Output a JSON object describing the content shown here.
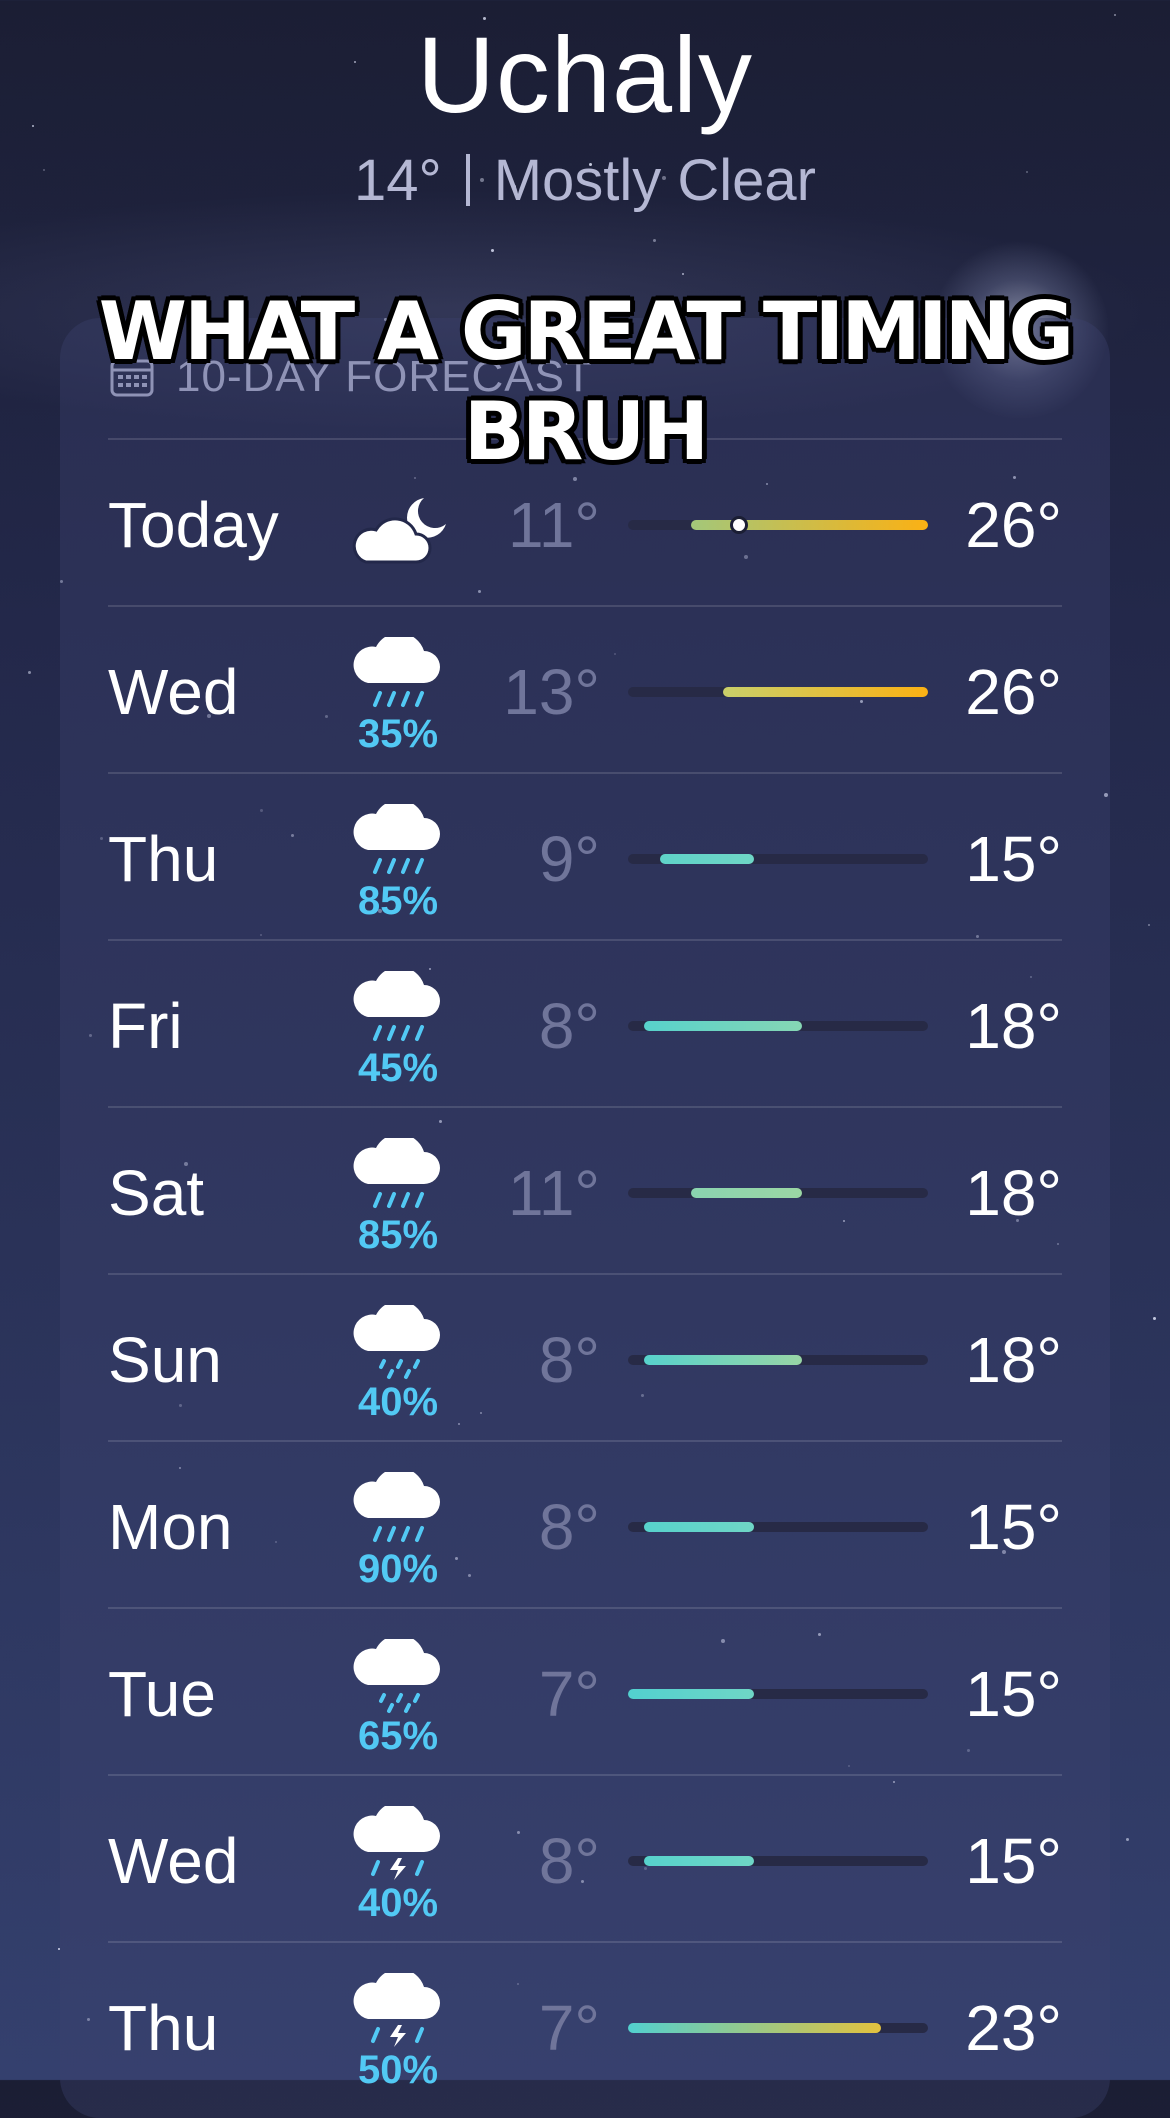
{
  "header": {
    "city": "Uchaly",
    "temp": "14°",
    "condition": "Mostly Clear"
  },
  "forecast": {
    "title": "10-DAY FORECAST",
    "icon": "calendar-icon"
  },
  "caption": {
    "line1": "WHAT A GREAT TIMING",
    "line2": "BRUH"
  },
  "scale": {
    "min": 7,
    "max": 26
  },
  "current_temp": 14,
  "days": [
    {
      "label": "Today",
      "icon": "moon-cloud-icon",
      "precip": "",
      "low": "11°",
      "high": "26°",
      "lo": 11,
      "hi": 26,
      "c1": "#a3c77a",
      "c2": "#fbb114",
      "now": true
    },
    {
      "label": "Wed",
      "icon": "rain-cloud-icon",
      "precip": "35%",
      "low": "13°",
      "high": "26°",
      "lo": 13,
      "hi": 26,
      "c1": "#c9cf6a",
      "c2": "#fbb114"
    },
    {
      "label": "Thu",
      "icon": "rain-cloud-icon",
      "precip": "85%",
      "low": "9°",
      "high": "15°",
      "lo": 9,
      "hi": 15,
      "c1": "#5fd3c8",
      "c2": "#6fd6c6"
    },
    {
      "label": "Fri",
      "icon": "rain-cloud-icon",
      "precip": "45%",
      "low": "8°",
      "high": "18°",
      "lo": 8,
      "hi": 18,
      "c1": "#57d2cc",
      "c2": "#86d6b4"
    },
    {
      "label": "Sat",
      "icon": "rain-cloud-icon",
      "precip": "85%",
      "low": "11°",
      "high": "18°",
      "lo": 11,
      "hi": 18,
      "c1": "#8ad4b0",
      "c2": "#9bd6a4"
    },
    {
      "label": "Sun",
      "icon": "drizzle-cloud-icon",
      "precip": "40%",
      "low": "8°",
      "high": "18°",
      "lo": 8,
      "hi": 18,
      "c1": "#57d2cc",
      "c2": "#98d5a6"
    },
    {
      "label": "Mon",
      "icon": "rain-cloud-icon",
      "precip": "90%",
      "low": "8°",
      "high": "15°",
      "lo": 8,
      "hi": 15,
      "c1": "#57d2cc",
      "c2": "#6fd6c6"
    },
    {
      "label": "Tue",
      "icon": "drizzle-cloud-icon",
      "precip": "65%",
      "low": "7°",
      "high": "15°",
      "lo": 7,
      "hi": 15,
      "c1": "#52d0cf",
      "c2": "#6fd6c6"
    },
    {
      "label": "Wed",
      "icon": "thunderstorm-cloud-icon",
      "precip": "40%",
      "low": "8°",
      "high": "15°",
      "lo": 8,
      "hi": 15,
      "c1": "#57d2cc",
      "c2": "#6fd6c6"
    },
    {
      "label": "Thu",
      "icon": "thunderstorm-cloud-icon",
      "precip": "50%",
      "low": "7°",
      "high": "23°",
      "lo": 7,
      "hi": 23,
      "c1": "#52d0cf",
      "c2": "#e3c23e"
    }
  ]
}
